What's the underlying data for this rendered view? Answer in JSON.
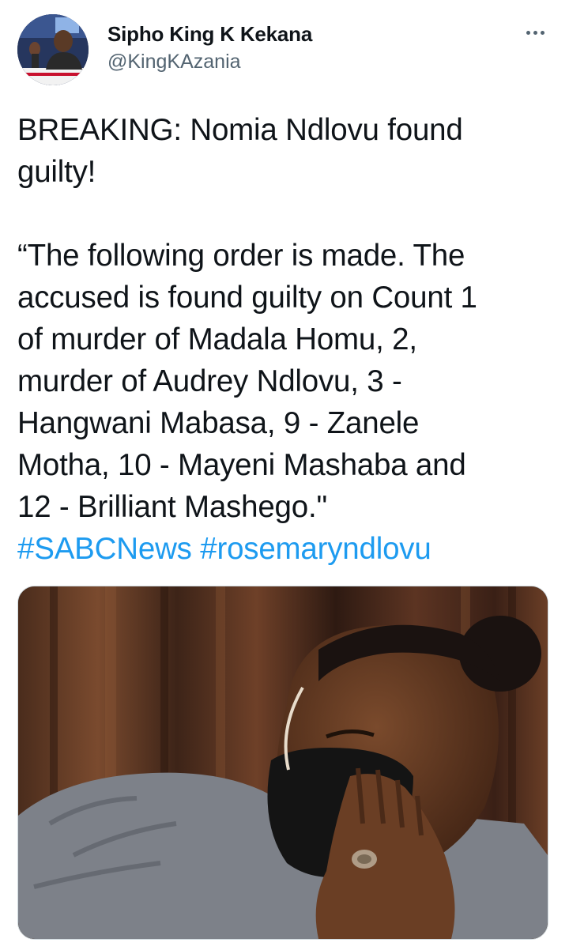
{
  "tweet": {
    "author": {
      "name": "Sipho King K Kekana",
      "handle": "@KingKAzania",
      "avatar_icon": "profile-photo"
    },
    "more_icon": "more-horizontal-icon",
    "text": {
      "headline": "BREAKING: Nomia Ndlovu found\nguilty!",
      "quote": "“The following order is made. The\naccused is found guilty on Count 1\nof murder of Madala Homu, 2,\nmurder of Audrey Ndlovu, 3 -\nHangwani Mabasa, 9 - Zanele\nMotha, 10 - Mayeni Mashaba and\n12 - Brilliant Mashego.\""
    },
    "hashtags": [
      "#SABCNews",
      "#rosemaryndlovu"
    ],
    "media": {
      "kind": "photo",
      "subject": "tweet-photo"
    }
  },
  "colors": {
    "link": "#1d9bf0",
    "secondary_text": "#536471",
    "primary_text": "#0f1419",
    "border": "#cfd9de"
  }
}
